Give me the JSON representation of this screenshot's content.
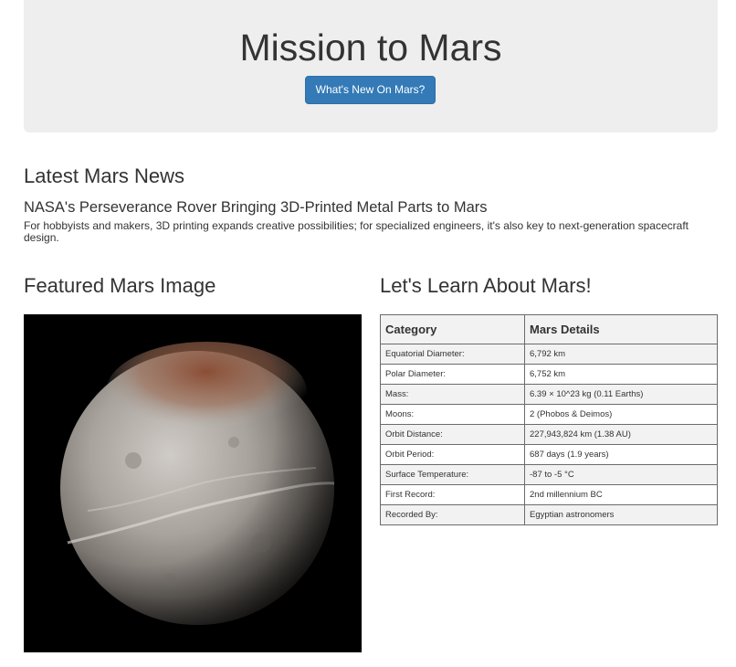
{
  "header": {
    "title": "Mission to Mars",
    "button_label": "What's New On Mars?"
  },
  "news": {
    "section_title": "Latest Mars News",
    "headline": "NASA's Perseverance Rover Bringing 3D-Printed Metal Parts to Mars",
    "teaser": "For hobbyists and makers, 3D printing expands creative possibilities; for specialized engineers, it's also key to next-generation spacecraft design."
  },
  "featured": {
    "section_title": "Featured Mars Image",
    "image_subject": "planet-globe"
  },
  "facts": {
    "section_title": "Let's Learn About Mars!",
    "columns": [
      "Category",
      "Mars Details"
    ],
    "rows": [
      [
        "Equatorial Diameter:",
        "6,792 km"
      ],
      [
        "Polar Diameter:",
        "6,752 km"
      ],
      [
        "Mass:",
        "6.39 × 10^23 kg (0.11 Earths)"
      ],
      [
        "Moons:",
        "2 (Phobos & Deimos)"
      ],
      [
        "Orbit Distance:",
        "227,943,824 km (1.38 AU)"
      ],
      [
        "Orbit Period:",
        "687 days (1.9 years)"
      ],
      [
        "Surface Temperature:",
        "-87 to -5 °C"
      ],
      [
        "First Record:",
        "2nd millennium BC"
      ],
      [
        "Recorded By:",
        "Egyptian astronomers"
      ]
    ]
  },
  "colors": {
    "jumbotron_bg": "#eeeeee",
    "button_bg": "#337ab7",
    "text": "#333333"
  }
}
